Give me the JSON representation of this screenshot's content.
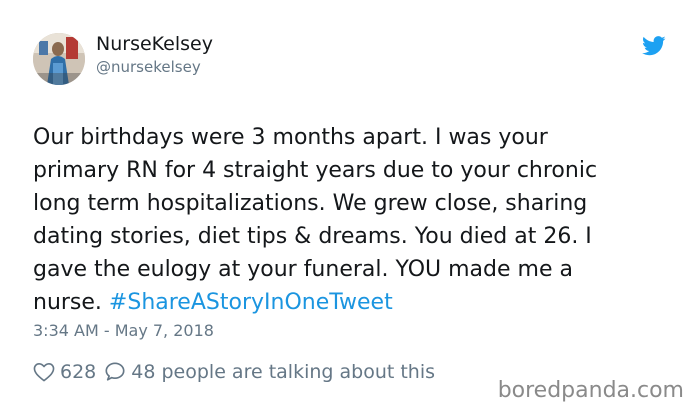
{
  "tweet": {
    "author": {
      "display_name": "NurseKelsey",
      "handle": "@nursekelsey",
      "avatar_icon": "profile-photo"
    },
    "platform_icon": "twitter-bird-icon",
    "text_lines": [
      "Our birthdays were 3 months apart. I was your",
      "primary RN for 4 straight years due to your chronic",
      "long term hospitalizations. We grew close, sharing",
      "dating stories, diet tips & dreams. You died at 26. I",
      "gave the eulogy at your funeral. YOU made me a",
      "nurse. "
    ],
    "hashtag": "#ShareAStoryInOneTweet",
    "timestamp": "3:34 AM - May 7, 2018",
    "likes": "628",
    "replies": "48 people are talking about this"
  },
  "watermark": "boredpanda.com",
  "colors": {
    "link": "#1b95e0",
    "twitter_blue": "#1da1f2",
    "secondary_text": "#657786",
    "primary_text": "#14171a"
  }
}
